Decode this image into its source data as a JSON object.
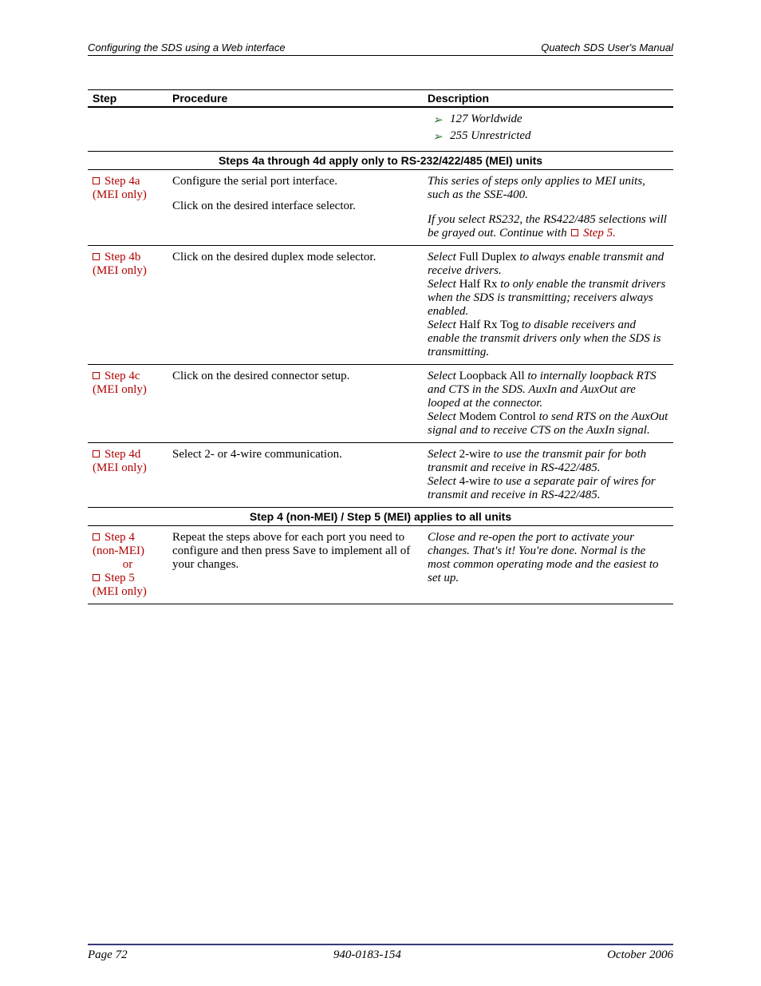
{
  "header": {
    "left": "Configuring the SDS using a Web interface",
    "right": "Quatech SDS User's Manual"
  },
  "table": {
    "headers": {
      "step": "Step",
      "procedure": "Procedure",
      "description": "Description"
    },
    "top_row": {
      "bullet1": "127 Worldwide",
      "bullet2": "255 Unrestricted"
    },
    "banner1": "Steps 4a through 4d apply only to RS-232/422/485 (MEI) units",
    "rows": {
      "r4a": {
        "step_label": "Step 4a",
        "step_sub": "(MEI only)",
        "proc1": "Configure the serial port interface.",
        "proc2": "Click on the desired interface selector.",
        "desc1": "This series of steps only applies to MEI units, such as the SSE-400.",
        "desc2a": "If you select RS232, the RS422/485 selections will be grayed out. Continue with ",
        "desc2link": "Step 5."
      },
      "r4b": {
        "step_label": "Step 4b",
        "step_sub": "(MEI only)",
        "proc": "Click on the desired duplex mode selector.",
        "desc_pre1": "Select ",
        "desc_b1": "Full Duplex",
        "desc_post1": " to always enable transmit and receive drivers.",
        "desc_pre2": "Select ",
        "desc_b2": "Half Rx",
        "desc_post2": " to only enable the transmit drivers when the SDS is transmitting; receivers always enabled.",
        "desc_pre3": "Select ",
        "desc_b3": "Half Rx Tog",
        "desc_post3": " to disable receivers and enable the transmit drivers only when the SDS is transmitting."
      },
      "r4c": {
        "step_label": "Step 4c",
        "step_sub": "(MEI only)",
        "proc": "Click on the desired connector setup.",
        "desc_pre1": "Select ",
        "desc_b1": "Loopback All",
        "desc_post1": " to internally loopback RTS and CTS in the SDS. AuxIn and AuxOut are looped at the connector.",
        "desc_pre2": "Select ",
        "desc_b2": "Modem Control",
        "desc_post2": " to send RTS on the AuxOut signal and to receive CTS on the AuxIn signal."
      },
      "r4d": {
        "step_label": "Step 4d",
        "step_sub": "(MEI only)",
        "proc": "Select 2- or 4-wire communication.",
        "desc_pre1": "Select ",
        "desc_b1": "2-wire",
        "desc_post1": " to use the transmit pair for both transmit and receive in RS-422/485.",
        "desc_pre2": "Select ",
        "desc_b2": "4-wire",
        "desc_post2": " to use a separate pair of wires for transmit and receive in RS-422/485."
      }
    },
    "banner2": "Step 4 (non-MEI) / Step 5 (MEI) applies to all units",
    "final": {
      "step_label1": "Step 4",
      "step_sub1": "(non-MEI)",
      "or": "or",
      "step_label2": "Step 5",
      "step_sub2": "(MEI only)",
      "proc": "Repeat the steps above for each port you need to configure and then press Save to implement all of your changes.",
      "desc": "Close and re-open the port to activate your changes. That's it! You're done. Normal is the most common operating mode and the easiest to set up."
    }
  },
  "footer": {
    "left": "Page 72",
    "center": "940-0183-154",
    "right": "October 2006"
  }
}
